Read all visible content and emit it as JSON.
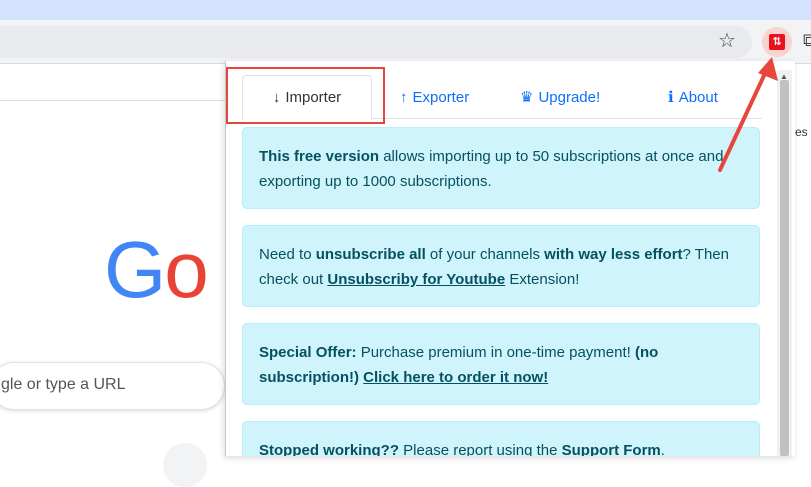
{
  "browser": {
    "star_icon": "star-icon",
    "extension_icon_glyph": "⇅",
    "puzzle_glyph": "⧉"
  },
  "page": {
    "logo_letters": [
      "G",
      "o"
    ],
    "search_placeholder": "gle or type a URL",
    "right_text": "es"
  },
  "popup": {
    "tabs": [
      {
        "icon": "↓",
        "label": "Importer"
      },
      {
        "icon": "↑",
        "label": "Exporter"
      },
      {
        "icon": "♛",
        "label": "Upgrade!"
      },
      {
        "icon": "ℹ",
        "label": "About"
      }
    ],
    "alerts": [
      {
        "bold1": "This free version",
        "text1": " allows importing up to 50 subscriptions at once and exporting up to 1000 subscriptions."
      },
      {
        "text1": "Need to ",
        "bold1": "unsubscribe all",
        "text2": " of your channels ",
        "bold2": "with way less effort",
        "text3": "? Then check out ",
        "link": "Unsubscriby for Youtube",
        "text4": " Extension!"
      },
      {
        "bold1": "Special Offer:",
        "text1": " Purchase premium in one-time payment! ",
        "bold2": "(no subscription!)",
        "text2": " ",
        "link": "Click here to order it now!"
      },
      {
        "bold1": "Stopped working??",
        "text1": " Please report using the ",
        "bold2": "Support Form",
        "text2": "."
      }
    ]
  },
  "colors": {
    "alert_bg": "#cff4fc",
    "alert_text": "#055160",
    "link_blue": "#0d6efd",
    "annotation_red": "#e8453c"
  }
}
